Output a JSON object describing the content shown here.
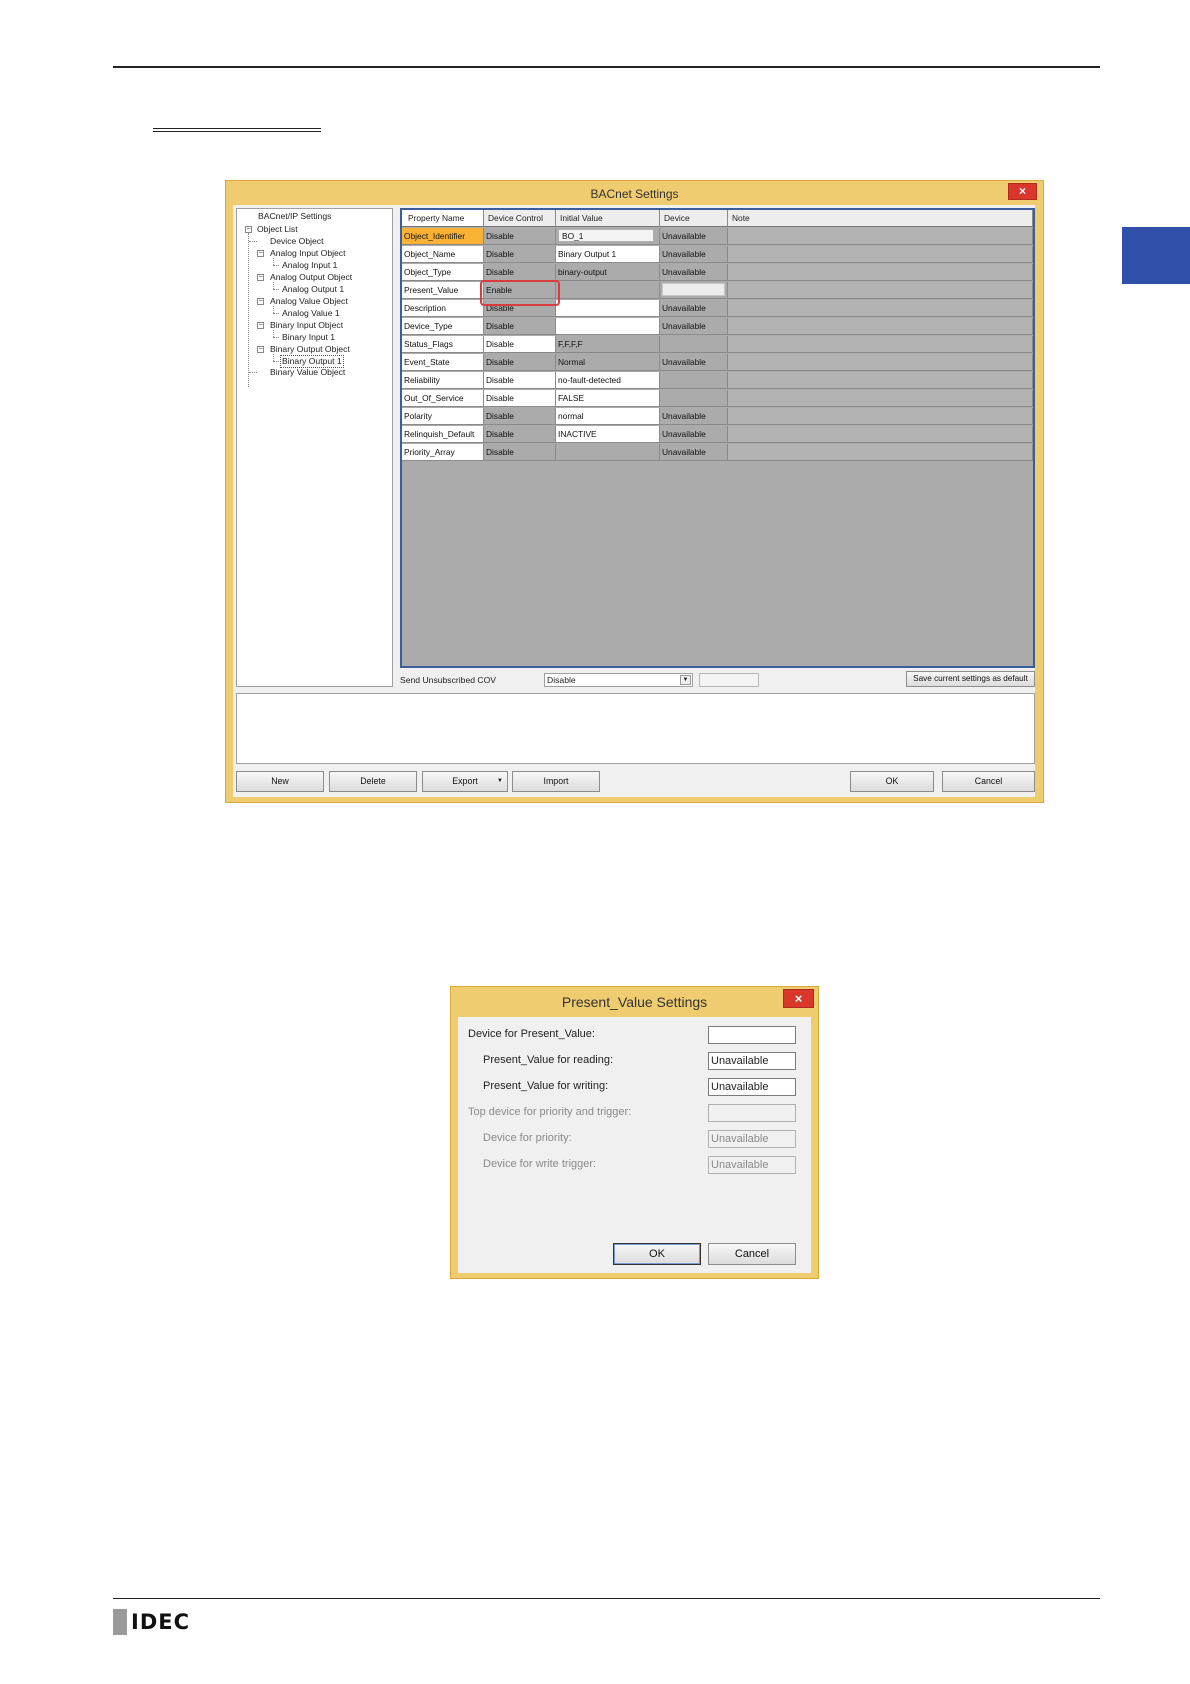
{
  "bacnet_window": {
    "title": "BACnet Settings",
    "close": "×",
    "tree": {
      "root": "BACnet/IP Settings",
      "object_list": "Object List",
      "nodes": [
        {
          "label": "Device Object"
        },
        {
          "label": "Analog Input Object",
          "child": "Analog Input 1"
        },
        {
          "label": "Analog Output Object",
          "child": "Analog Output 1"
        },
        {
          "label": "Analog Value Object",
          "child": "Analog Value 1"
        },
        {
          "label": "Binary Input Object",
          "child": "Binary Input 1"
        },
        {
          "label": "Binary Output Object",
          "child": "Binary Output 1"
        },
        {
          "label": "Binary Value Object"
        }
      ]
    },
    "grid": {
      "headers": [
        "Property Name",
        "Device Control",
        "Initial Value",
        "Device",
        "Note"
      ],
      "rows": [
        {
          "name": "Object_Identifier",
          "control": "Disable",
          "initial": "BO_1",
          "device": "Unavailable",
          "note": ""
        },
        {
          "name": "Object_Name",
          "control": "Disable",
          "initial": "Binary Output 1",
          "device": "Unavailable",
          "note": ""
        },
        {
          "name": "Object_Type",
          "control": "Disable",
          "initial": "binary-output",
          "device": "Unavailable",
          "note": ""
        },
        {
          "name": "Present_Value",
          "control": "Enable",
          "initial": "",
          "device": "",
          "note": ""
        },
        {
          "name": "Description",
          "control": "Disable",
          "initial": "",
          "device": "Unavailable",
          "note": ""
        },
        {
          "name": "Device_Type",
          "control": "Disable",
          "initial": "",
          "device": "Unavailable",
          "note": ""
        },
        {
          "name": "Status_Flags",
          "control": "Disable",
          "initial": "F,F,F,F",
          "device": "",
          "note": ""
        },
        {
          "name": "Event_State",
          "control": "Disable",
          "initial": "Normal",
          "device": "Unavailable",
          "note": ""
        },
        {
          "name": "Reliability",
          "control": "Disable",
          "initial": "no-fault-detected",
          "device": "",
          "note": ""
        },
        {
          "name": "Out_Of_Service",
          "control": "Disable",
          "initial": "FALSE",
          "device": "",
          "note": ""
        },
        {
          "name": "Polarity",
          "control": "Disable",
          "initial": "normal",
          "device": "Unavailable",
          "note": ""
        },
        {
          "name": "Relinquish_Default",
          "control": "Disable",
          "initial": "INACTIVE",
          "device": "Unavailable",
          "note": ""
        },
        {
          "name": "Priority_Array",
          "control": "Disable",
          "initial": "",
          "device": "Unavailable",
          "note": ""
        }
      ]
    },
    "cov_label": "Send Unsubscribed COV",
    "cov_value": "Disable",
    "save_default": "Save current settings as default",
    "buttons": {
      "new": "New",
      "delete": "Delete",
      "export": "Export",
      "import": "Import",
      "ok": "OK",
      "cancel": "Cancel"
    }
  },
  "pv_window": {
    "title": "Present_Value Settings",
    "close": "×",
    "device_label": "Device for Present_Value:",
    "device_value": "",
    "reading_label": "Present_Value for reading:",
    "reading_value": "Unavailable",
    "writing_label": "Present_Value for writing:",
    "writing_value": "Unavailable",
    "top_label": "Top device for priority and trigger:",
    "top_value": "",
    "priority_label": "Device for priority:",
    "priority_value": "Unavailable",
    "trigger_label": "Device for write trigger:",
    "trigger_value": "Unavailable",
    "ok": "OK",
    "cancel": "Cancel"
  },
  "footer": {
    "brand": "IDEC"
  },
  "colors": {
    "accent_tab": "#2f4fa8",
    "window_frame": "#f0cc70",
    "highlight": "#d83c3c",
    "selected_row": "#f9b233"
  }
}
